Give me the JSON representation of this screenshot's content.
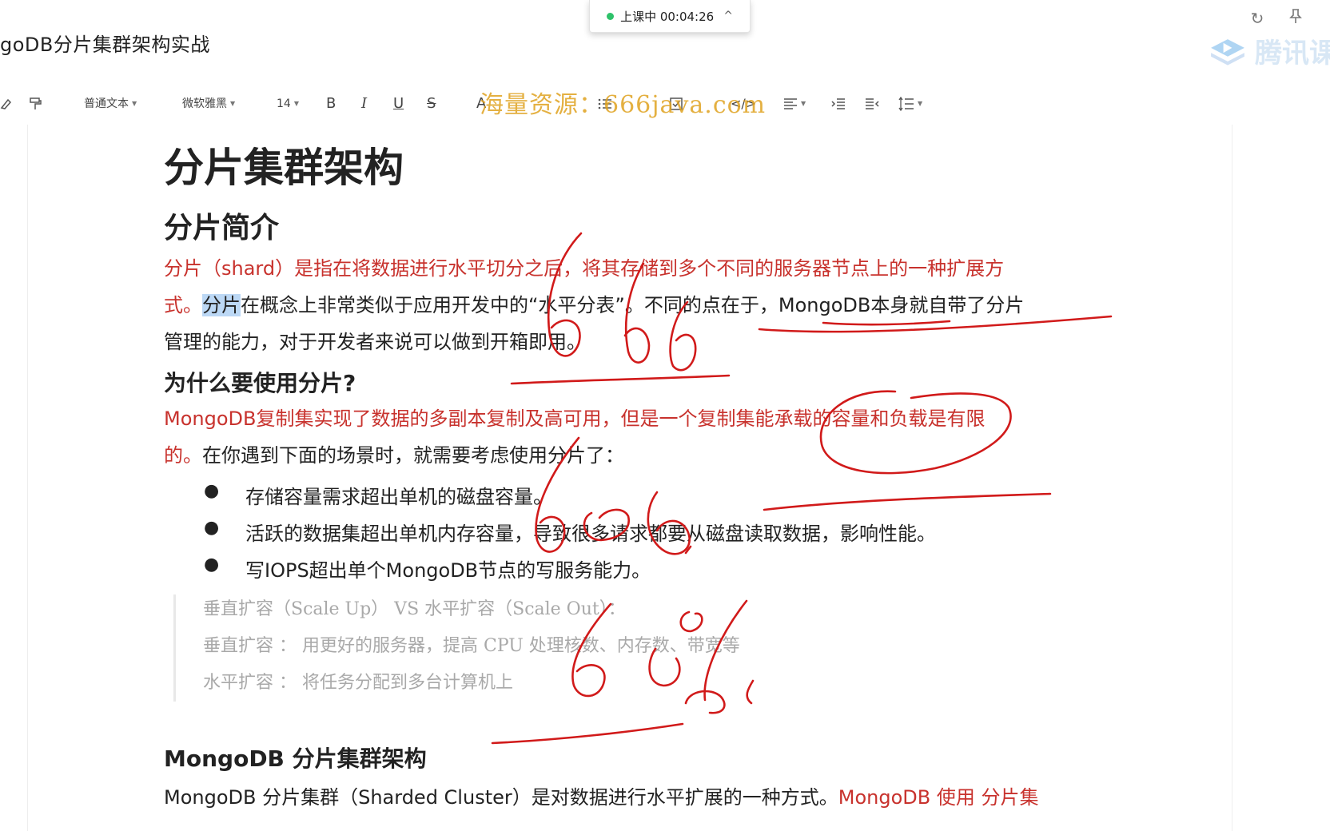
{
  "window": {
    "doc_title": "goDB分片集群架构实战"
  },
  "live": {
    "status": "上课中 00:04:26",
    "chevron": "^"
  },
  "brand": {
    "name": "腾讯课"
  },
  "toolbar": {
    "paragraph_style": "普通文本",
    "font_family": "微软雅黑",
    "font_size": "14",
    "bold": "B",
    "italic": "I",
    "underline": "U",
    "strike": "S",
    "code": "</>"
  },
  "watermark": "海量资源：666java.com",
  "doc": {
    "h1": "分片集群架构",
    "h2": "分片简介",
    "intro_line1": "分片（shard）是指在将数据进行水平切分之后，将其存储到多个不同的服务器节点上的一种扩展方",
    "intro_line2_red": "式。",
    "intro_line2_sel": "分片",
    "intro_line2_rest": "在概念上非常类似于应用开发中的“水平分表”。不同的点在于，MongoDB本身就自带了分片",
    "intro_line3": "管理的能力，对于开发者来说可以做到开箱即用。",
    "h3_why": "为什么要使用分片?",
    "why_line1": "MongoDB复制集实现了数据的多副本复制及高可用，但是一个复制集能承载的容量和负载是有限",
    "why_line2_red": "的。",
    "why_line2_rest": "在你遇到下面的场景时，就需要考虑使用分片了：",
    "bullets": [
      "存储容量需求超出单机的磁盘容量。",
      "活跃的数据集超出单机内存容量，导致很多请求都要从磁盘读取数据，影响性能。",
      "写IOPS超出单个MongoDB节点的写服务能力。"
    ],
    "code_lines": [
      "垂直扩容（Scale Up） VS 水平扩容（Scale Out）：",
      "垂直扩容 ： 用更好的服务器，提高 CPU 处理核数、内存数、带宽等",
      "水平扩容 ： 将任务分配到多台计算机上"
    ],
    "h3_arch": "MongoDB 分片集群架构",
    "arch_line1_black": "MongoDB 分片集群（Sharded Cluster）是对数据进行水平扩展的一种方式。",
    "arch_line1_red": "MongoDB 使用 分片集"
  }
}
